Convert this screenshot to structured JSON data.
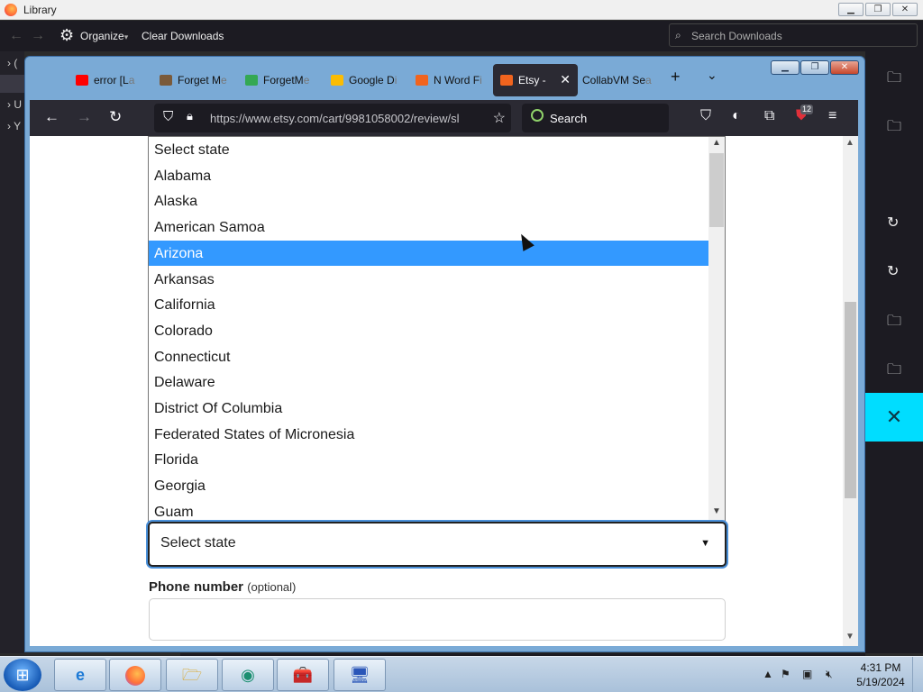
{
  "library": {
    "title": "Library",
    "organize_label": "Organize",
    "organize_caret": "▾",
    "clear_downloads_label": "Clear Downloads",
    "search_placeholder": "Search Downloads",
    "left_rows": [
      "›",
      "›",
      "›"
    ],
    "left_row_letters": [
      "(",
      "U",
      "Y"
    ]
  },
  "browser": {
    "tabs": [
      {
        "label": "error [L",
        "fade": "a",
        "icon": "youtube-icon",
        "color": "#ff0000"
      },
      {
        "label": "Forget M",
        "fade": "e",
        "icon": "image-favicon-icon",
        "color": "#7a5a3a"
      },
      {
        "label": "ForgetM",
        "fade": "e",
        "icon": "google-drive-icon",
        "color": "#34a853"
      },
      {
        "label": "Google D",
        "fade": "i",
        "icon": "google-drive-icon",
        "color": "#fbbc04"
      },
      {
        "label": "N Word F",
        "fade": "i",
        "icon": "etsy-icon",
        "color": "#f1641e"
      },
      {
        "label": "Etsy -",
        "fade": "",
        "icon": "etsy-icon",
        "color": "#f1641e",
        "active": true
      },
      {
        "label": "CollabVM Se",
        "fade": "a",
        "icon": "",
        "color": ""
      }
    ],
    "url": "https://www.etsy.com/cart/9981058002/review/sl",
    "search_label": "Search",
    "extension_badge": "12"
  },
  "form": {
    "state_options": [
      "Select state",
      "Alabama",
      "Alaska",
      "American Samoa",
      "Arizona",
      "Arkansas",
      "California",
      "Colorado",
      "Connecticut",
      "Delaware",
      "District Of Columbia",
      "Federated States of Micronesia",
      "Florida",
      "Georgia",
      "Guam"
    ],
    "selected_highlight": "Arizona",
    "select_value": "Select state",
    "phone_label": "Phone number",
    "phone_optional": "(optional)"
  },
  "taskbar": {
    "time": "4:31 PM",
    "date": "5/19/2024",
    "items": [
      "internet-explorer-icon",
      "firefox-icon",
      "file-explorer-icon",
      "app-icon",
      "toolbox-icon",
      "remote-desktop-icon"
    ]
  },
  "colors": {
    "highlight": "#3399ff",
    "accent_panel": "#00ddff",
    "browser_toolbar": "#2b2a33"
  }
}
